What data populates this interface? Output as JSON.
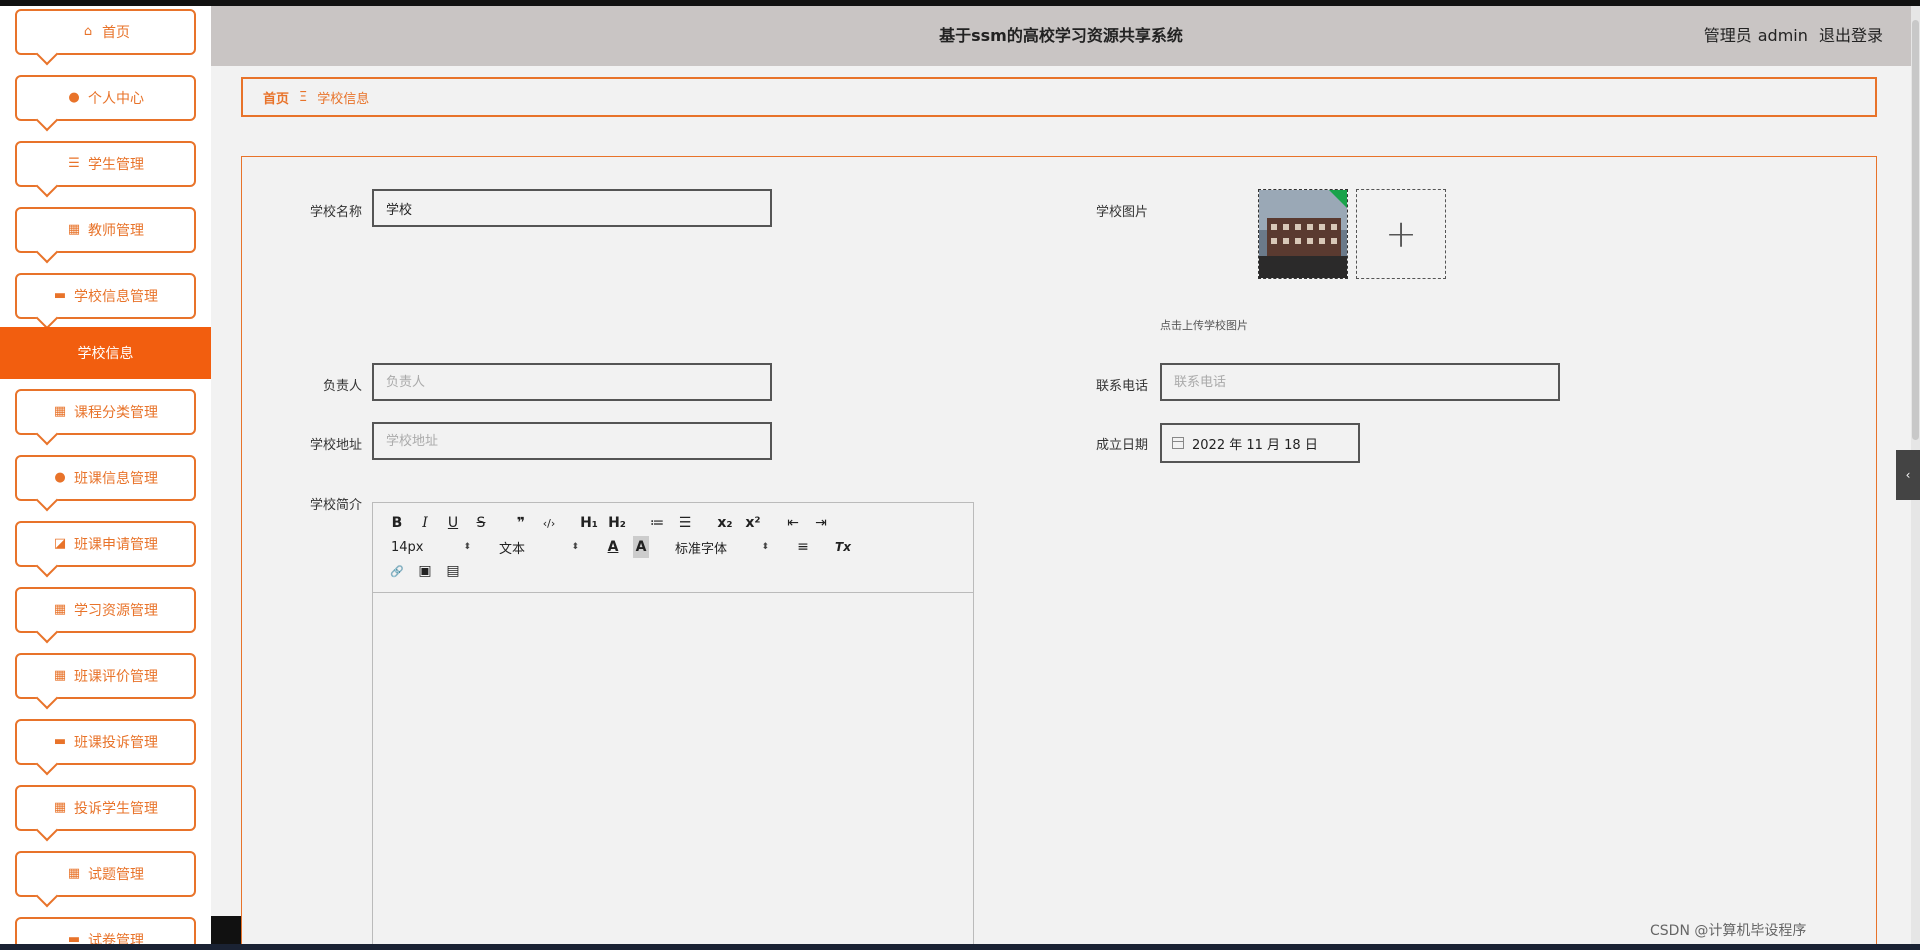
{
  "header": {
    "title": "基于ssm的高校学习资源共享系统",
    "role": "管理员",
    "user": "admin",
    "logout": "退出登录"
  },
  "sidebar": {
    "items": [
      {
        "label": "首页",
        "icon": "home-icon"
      },
      {
        "label": "个人中心",
        "icon": "person-icon"
      },
      {
        "label": "学生管理",
        "icon": "list-icon"
      },
      {
        "label": "教师管理",
        "icon": "grid-icon"
      },
      {
        "label": "学校信息管理",
        "icon": "briefcase-icon"
      },
      {
        "label": "课程分类管理",
        "icon": "grid-icon"
      },
      {
        "label": "班课信息管理",
        "icon": "person-icon"
      },
      {
        "label": "班课申请管理",
        "icon": "chart-icon"
      },
      {
        "label": "学习资源管理",
        "icon": "grid-icon"
      },
      {
        "label": "班课评价管理",
        "icon": "grid-icon"
      },
      {
        "label": "班课投诉管理",
        "icon": "monitor-icon"
      },
      {
        "label": "投诉学生管理",
        "icon": "grid-icon"
      },
      {
        "label": "试题管理",
        "icon": "grid-icon"
      },
      {
        "label": "试卷管理",
        "icon": "briefcase-icon"
      }
    ],
    "active_sub": "学校信息"
  },
  "breadcrumb": {
    "home": "首页",
    "separator": "Ξ",
    "current": "学校信息"
  },
  "form": {
    "school_name_label": "学校名称",
    "school_name_value": "学校",
    "school_image_label": "学校图片",
    "upload_hint": "点击上传学校图片",
    "upload_plus": "+",
    "manager_label": "负责人",
    "manager_placeholder": "负责人",
    "phone_label": "联系电话",
    "phone_placeholder": "联系电话",
    "address_label": "学校地址",
    "address_placeholder": "学校地址",
    "founded_label": "成立日期",
    "founded_value": "2022 年 11 月 18 日",
    "intro_label": "学校简介"
  },
  "editor": {
    "row1": [
      "B",
      "I",
      "U",
      "S",
      "❞",
      "‹/›",
      "H₁",
      "H₂",
      "≔",
      "☰",
      "x₂",
      "x²",
      "⇤",
      "⇥"
    ],
    "font_size": "14px",
    "block_type": "文本",
    "font_family": "标准字体",
    "caret": "⬍",
    "color_btn": "A",
    "bg_btn": "A",
    "align_btn": "≡",
    "clear_btn": "Tx",
    "link_btn": "🔗",
    "image_btn": "▣",
    "video_btn": "▤"
  },
  "watermark": "CSDN @计算机毕设程序",
  "colors": {
    "accent": "#e8732a",
    "active": "#f25e0f",
    "header_bg": "#c9c5c4"
  }
}
